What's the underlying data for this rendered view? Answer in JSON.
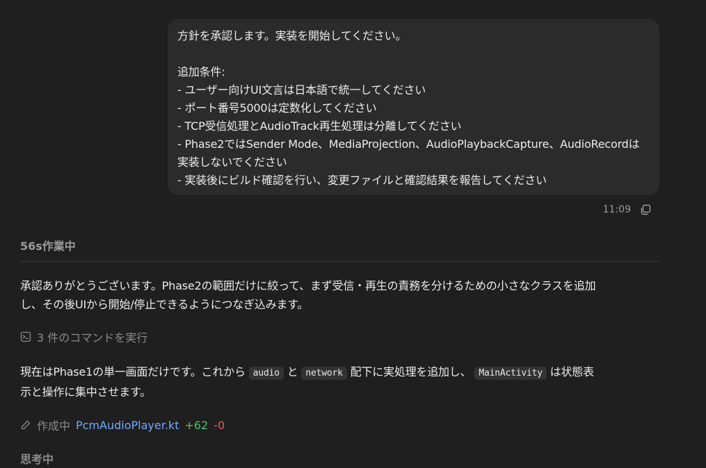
{
  "user_message": {
    "line1": "方針を承認します。実装を開始してください。",
    "line2": "追加条件:",
    "line3": "- ユーザー向けUI文言は日本語で統一してください",
    "line4": "- ポート番号5000は定数化してください",
    "line5": "- TCP受信処理とAudioTrack再生処理は分離してください",
    "line6": "- Phase2ではSender Mode、MediaProjection、AudioPlaybackCapture、AudioRecordは",
    "line7": "実装しないでください",
    "line8": "- 実装後にビルド確認を行い、変更ファイルと確認結果を報告してください",
    "time": "11:09"
  },
  "status": {
    "working": "56s作業中"
  },
  "assistant": {
    "para1_line1": "承認ありがとうございます。Phase2の範囲だけに絞って、まず受信・再生の責務を分けるための小さなクラスを追加",
    "para1_line2": "し、その後UIから開始/停止できるようにつなぎ込みます。",
    "commands_label": "3 件のコマンドを実行",
    "para2_part1": "現在はPhase1の単一画面だけです。これから ",
    "code_audio": "audio",
    "para2_part2": " と ",
    "code_network": "network",
    "para2_part3": " 配下に実処理を追加し、 ",
    "code_main": "MainActivity",
    "para2_part4": " は状態表",
    "para2_line2": "示と操作に集中させます。",
    "edit_label": "作成中",
    "edit_file": "PcmAudioPlayer.kt",
    "edit_added": "+62",
    "edit_removed": "-0",
    "thinking": "思考中"
  },
  "icons": {
    "copy": "copy-icon",
    "terminal": "terminal-icon",
    "pencil": "pencil-icon"
  },
  "colors": {
    "background": "#1f1f1f",
    "bubble": "#2b2b2b",
    "link": "#6fa8ff",
    "added": "#4ec36b",
    "removed": "#f05a5a"
  }
}
